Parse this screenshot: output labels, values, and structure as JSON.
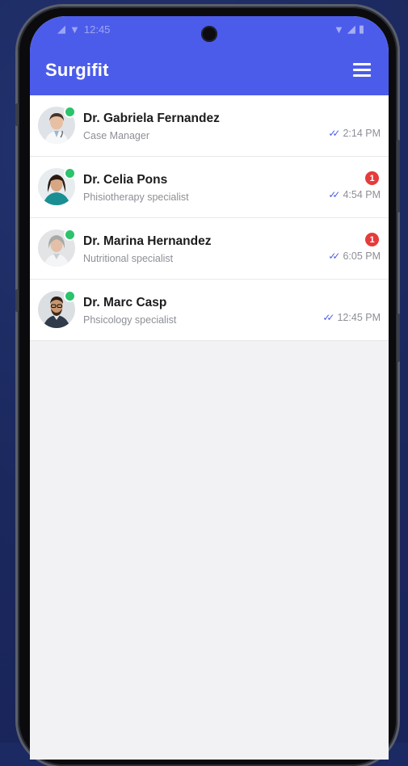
{
  "status_bar": {
    "time": "12:45"
  },
  "app": {
    "title": "Surgifit"
  },
  "chats": [
    {
      "name": "Dr. Gabriela Fernandez",
      "role": "Case Manager",
      "time": "2:14 PM",
      "unread": "",
      "online": true
    },
    {
      "name": "Dr. Celia Pons",
      "role": "Phisiotherapy specialist",
      "time": "4:54 PM",
      "unread": "1",
      "online": true
    },
    {
      "name": "Dr. Marina Hernandez",
      "role": "Nutritional specialist",
      "time": "6:05 PM",
      "unread": "1",
      "online": true
    },
    {
      "name": "Dr. Marc Casp",
      "role": "Phsicology specialist",
      "time": "12:45 PM",
      "unread": "",
      "online": true
    }
  ],
  "icons": {
    "menu": "hamburger-menu-icon",
    "read_receipt": "double-check-icon",
    "online": "online-status-dot"
  },
  "colors": {
    "primary": "#4c5cea",
    "online": "#2bc36b",
    "badge": "#e63b3b",
    "background": "#1c2a63"
  }
}
